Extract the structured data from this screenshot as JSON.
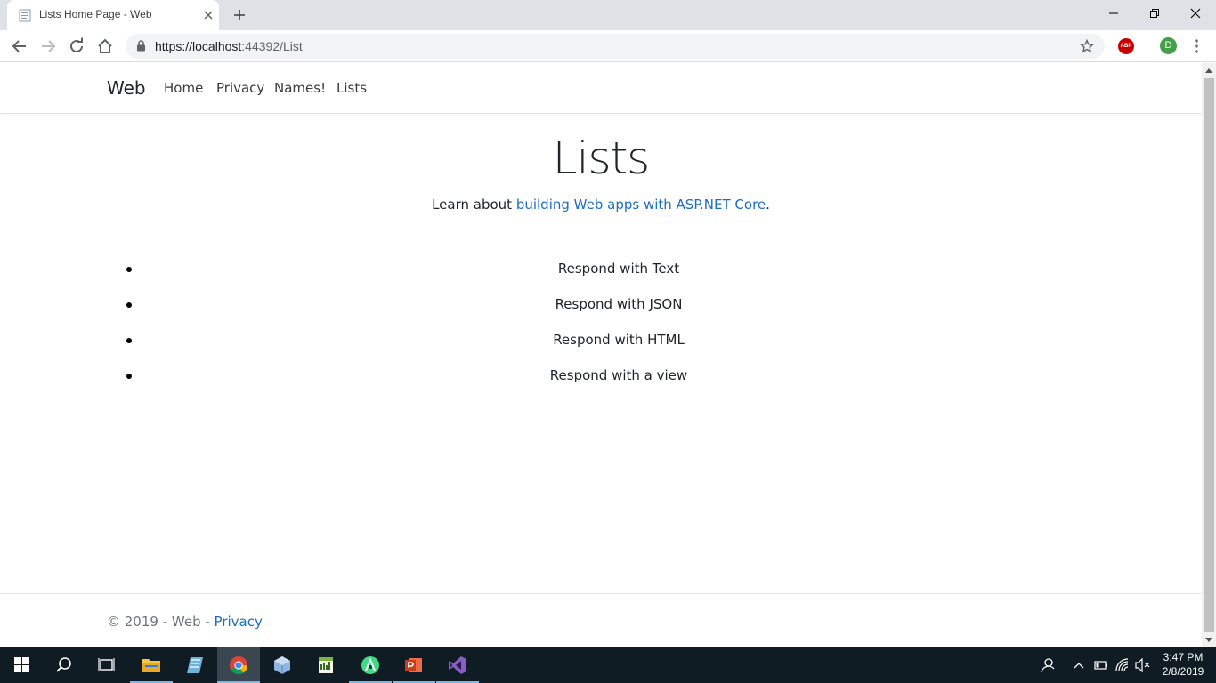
{
  "browser": {
    "tab_title": "Lists Home Page - Web",
    "url_host": "https://localhost",
    "url_rest": ":44392/List",
    "abp_label": "ABP",
    "profile_initial": "D"
  },
  "site": {
    "brand": "Web",
    "nav": [
      "Home",
      "Privacy",
      "Names!",
      "Lists"
    ]
  },
  "page": {
    "title": "Lists",
    "subtitle_prefix": "Learn about ",
    "subtitle_link": "building Web apps with ASP.NET Core",
    "subtitle_suffix": ".",
    "items": [
      "Respond with Text",
      "Respond with JSON",
      "Respond with HTML",
      "Respond with a view"
    ]
  },
  "footer": {
    "copyright": "© 2019 - Web - ",
    "privacy_link": "Privacy"
  },
  "taskbar": {
    "time": "3:47 PM",
    "date": "2/8/2019",
    "apps": [
      "start-icon",
      "search-icon",
      "task-view-icon",
      "file-explorer-icon",
      "notepad-icon",
      "chrome-icon",
      "virtualbox-icon",
      "spreadsheet-icon",
      "android-studio-icon",
      "powerpoint-icon",
      "visual-studio-icon"
    ]
  },
  "colors": {
    "link": "#1b6ec2",
    "taskbar": "#101c24",
    "tabstrip": "#dee1e6"
  }
}
